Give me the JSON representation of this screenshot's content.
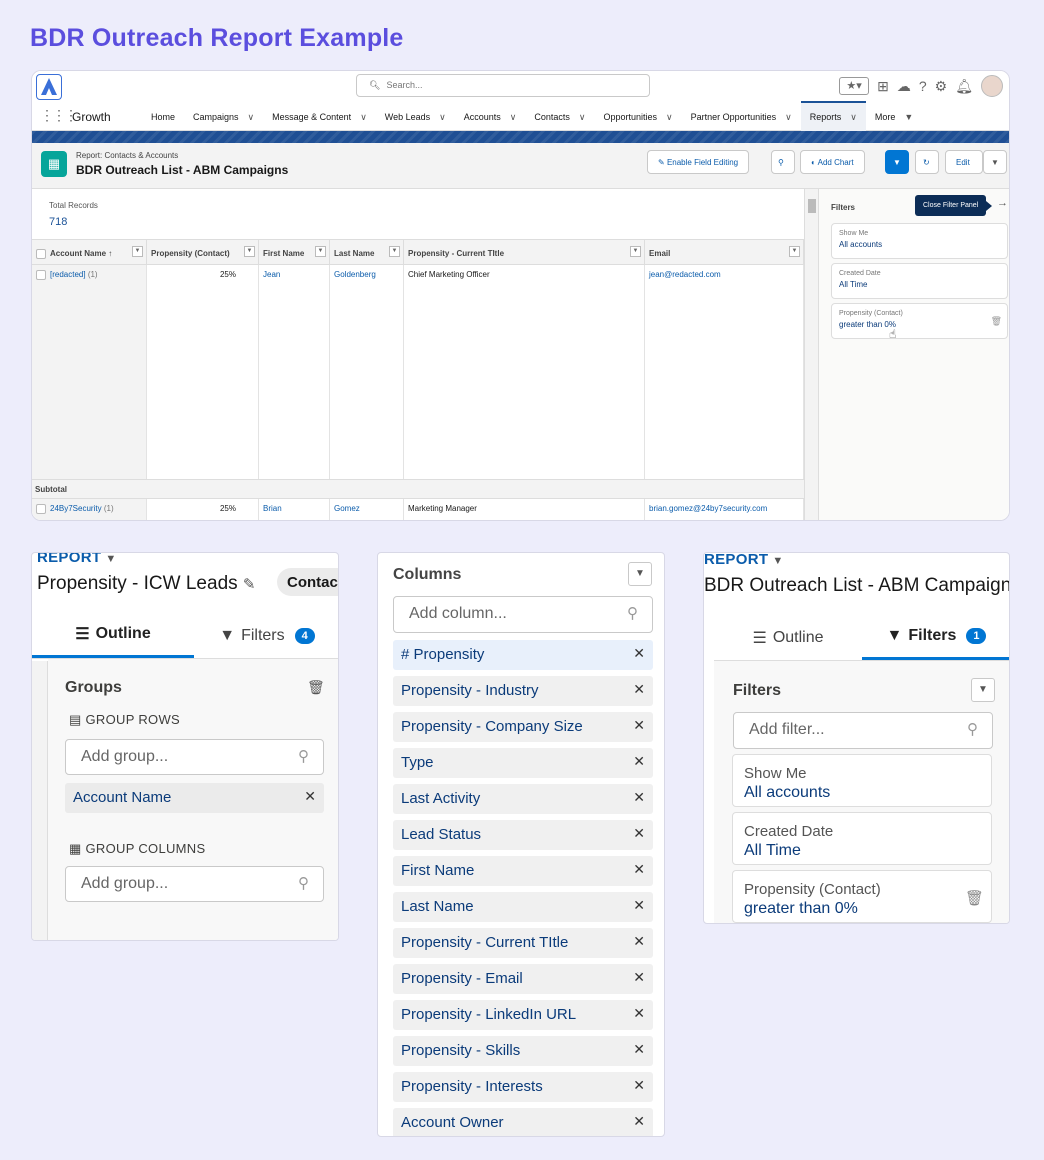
{
  "page_title": "BDR Outreach Report Example",
  "salesforce": {
    "search_placeholder": "Search...",
    "app_name": "Growth",
    "nav": [
      {
        "label": "Home",
        "caret": false
      },
      {
        "label": "Campaigns",
        "caret": true
      },
      {
        "label": "Message & Content",
        "caret": true
      },
      {
        "label": "Web Leads",
        "caret": true
      },
      {
        "label": "Accounts",
        "caret": true
      },
      {
        "label": "Contacts",
        "caret": true
      },
      {
        "label": "Opportunities",
        "caret": true
      },
      {
        "label": "Partner Opportunities",
        "caret": true
      },
      {
        "label": "Reports",
        "caret": true,
        "active": true
      },
      {
        "label": "More",
        "caret": true
      }
    ],
    "report_subtitle": "Report: Contacts & Accounts",
    "report_title": "BDR Outreach List - ABM Campaigns",
    "buttons": {
      "enable_field_editing": "Enable Field Editing",
      "add_chart": "Add Chart",
      "edit": "Edit"
    },
    "total_records_label": "Total Records",
    "total_records_value": "718",
    "columns": [
      "Account Name",
      "Propensity (Contact)",
      "First Name",
      "Last Name",
      "Propensity - Current TItle",
      "Email"
    ],
    "rows": [
      {
        "account": "[redacted]",
        "count": "(1)",
        "propensity": "25%",
        "first": "Jean",
        "last": "Goldenberg",
        "title": "Chief Marketing Officer",
        "email": "jean@redacted.com"
      },
      {
        "account": "24By7Security",
        "count": "(1)",
        "propensity": "25%",
        "first": "Brian",
        "last": "Gomez",
        "title": "Marketing Manager",
        "email": "brian.gomez@24by7security.com"
      }
    ],
    "subtotal_label": "Subtotal",
    "filters_title": "Filters",
    "close_filter_tooltip": "Close Filter Panel",
    "filters": [
      {
        "label": "Show Me",
        "value": "All accounts"
      },
      {
        "label": "Created Date",
        "value": "All Time"
      },
      {
        "label": "Propensity (Contact)",
        "value": "greater than 0%"
      }
    ]
  },
  "panel_outline": {
    "report_label": "REPORT",
    "report_title": "Propensity - ICW Leads",
    "chip": "Contac",
    "tab_outline": "Outline",
    "tab_filters": "Filters",
    "filters_badge": "4",
    "groups_title": "Groups",
    "group_rows_label": "GROUP ROWS",
    "add_group_placeholder": "Add group...",
    "group_row_item": "Account Name",
    "group_columns_label": "GROUP COLUMNS",
    "add_group_placeholder_2": "Add group..."
  },
  "panel_columns": {
    "title": "Columns",
    "add_column_placeholder": "Add column...",
    "items": [
      "# Propensity",
      "Propensity - Industry",
      "Propensity - Company Size",
      "Type",
      "Last Activity",
      "Lead Status",
      "First Name",
      "Last Name",
      "Propensity - Current TItle",
      "Propensity - Email",
      "Propensity - LinkedIn URL",
      "Propensity - Skills",
      "Propensity - Interests",
      "Account Owner"
    ]
  },
  "panel_filters": {
    "report_label": "REPORT",
    "report_title": "BDR Outreach List - ABM Campaign",
    "tab_outline": "Outline",
    "tab_filters": "Filters",
    "filters_badge": "1",
    "filters_title": "Filters",
    "add_filter_placeholder": "Add filter...",
    "filters": [
      {
        "label": "Show Me",
        "value": "All accounts"
      },
      {
        "label": "Created Date",
        "value": "All Time"
      },
      {
        "label": "Propensity (Contact)",
        "value": "greater than 0%"
      }
    ]
  }
}
